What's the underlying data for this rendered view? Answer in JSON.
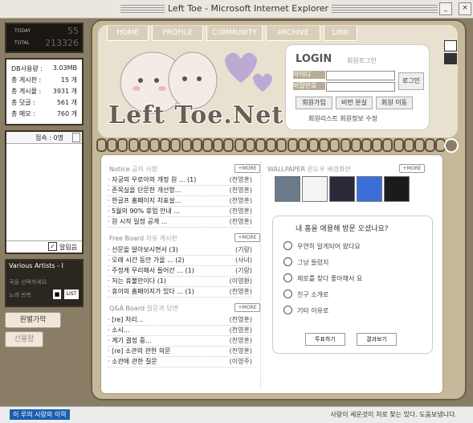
{
  "window": {
    "title": "Left Toe - Microsoft Internet Explorer",
    "min_label": "_",
    "max_label": "□",
    "close_label": "×"
  },
  "counter": {
    "today_label": "TODAY",
    "today_value": "55",
    "total_label": "TOTAL",
    "total_value": "213326"
  },
  "stats": [
    {
      "label": "DB사용량 :",
      "value": "3.03MB"
    },
    {
      "label": "총 게시판 :",
      "value": "15 개"
    },
    {
      "label": "총 게시물 :",
      "value": "3931 개"
    },
    {
      "label": "총 덧글 :",
      "value": "561 개"
    },
    {
      "label": "총 메모 :",
      "value": "760 개"
    }
  ],
  "chat": {
    "header": "접속 : 0명",
    "footer_label": "알림음"
  },
  "music": {
    "title": "Various Artists - I",
    "line1": "곡을 선택하세요",
    "line2": "노래 반복",
    "stop_label": "■",
    "list_label": "LIST"
  },
  "side_buttons": [
    {
      "label": "원별가락"
    },
    {
      "label": "선물함"
    }
  ],
  "nav_tabs": [
    {
      "label": "HOME"
    },
    {
      "label": "PROFILE"
    },
    {
      "label": "COMMUNITY"
    },
    {
      "label": "ARCHIVE"
    },
    {
      "label": "LINK"
    }
  ],
  "logo_text": "Left Toe.Net",
  "login": {
    "title": "LOGIN",
    "subtitle": "회원로그인",
    "id_label": "아이디",
    "pw_label": "비밀번호",
    "submit_label": "로그인",
    "join_label": "회원가입",
    "find_label": "비번 분실",
    "leave_label": "회원 이동",
    "links": "회원리스트 회원정보 수정"
  },
  "notice": {
    "section_en": "Notice",
    "section_ko": "공지 사항",
    "more": "+MORE",
    "items": [
      {
        "title": "· 자궁의 우로아의 개정 원 ... (1)",
        "author": "(천영훈)"
      },
      {
        "title": "· 존목실을 단문한 개선항...",
        "author": "(천영훈)"
      },
      {
        "title": "· 한글프 홈페이지 차표살...",
        "author": "(천영훈)"
      },
      {
        "title": "· 5월의 90% 휴업 안내 ...",
        "author": "(천영훈)"
      },
      {
        "title": "· 원 시작 일정 공개 ...",
        "author": "(천영훈)"
      }
    ]
  },
  "free": {
    "section_en": "Free Board",
    "section_ko": "자유 게시판",
    "more": "+MORE",
    "items": [
      {
        "title": "· 선문을 알아보시면서 (3)",
        "author": "(기랑)"
      },
      {
        "title": "· 오래 시간 동안 가을 ... (2)",
        "author": "(사녀)"
      },
      {
        "title": "· 주정게 무리해서 들어간 ... (1)",
        "author": "(기랑)"
      },
      {
        "title": "· 저는 휴불만이다 (1)",
        "author": "(이영환)"
      },
      {
        "title": "· 휴이의 홈페이지가 있다 ... (1)",
        "author": "(천영훈)"
      }
    ]
  },
  "qa": {
    "section_en": "Q&A Board",
    "section_ko": "질문과 답변",
    "more": "+MORE",
    "items": [
      {
        "title": "· [re] 처리...",
        "author": "(천영훈)"
      },
      {
        "title": "· 소시...",
        "author": "(천영훈)"
      },
      {
        "title": "· 계기 결정 중...",
        "author": "(천영훈)"
      },
      {
        "title": "· [re] 소관의 관한 의문",
        "author": "(천영훈)"
      },
      {
        "title": "· 소관에 관한 질문",
        "author": "(이영주)"
      }
    ]
  },
  "wallpaper": {
    "section_en": "WALLPAPER",
    "section_ko": "윈도우 배경화면",
    "more": "+MORE",
    "thumbs": [
      "#6a7a8a",
      "#f4f4f4",
      "#2a2a3a",
      "#3b6fd8",
      "#1b1b1b"
    ]
  },
  "poll": {
    "question": "내 홈을 애용해 방문 오셨나요?",
    "options": [
      "우연히 알게되어 왔다요",
      "그냥 들렀지",
      "제로를 찾다 좋아해서 요",
      "친구 소개로",
      "기타 이유로"
    ],
    "vote_label": "투표하기",
    "result_label": "결과보기"
  },
  "status": {
    "left": "이 루의 시랑의 이력",
    "right": "사랑이 세운것이 처로 찾는 있다. 도움보냅니다."
  }
}
